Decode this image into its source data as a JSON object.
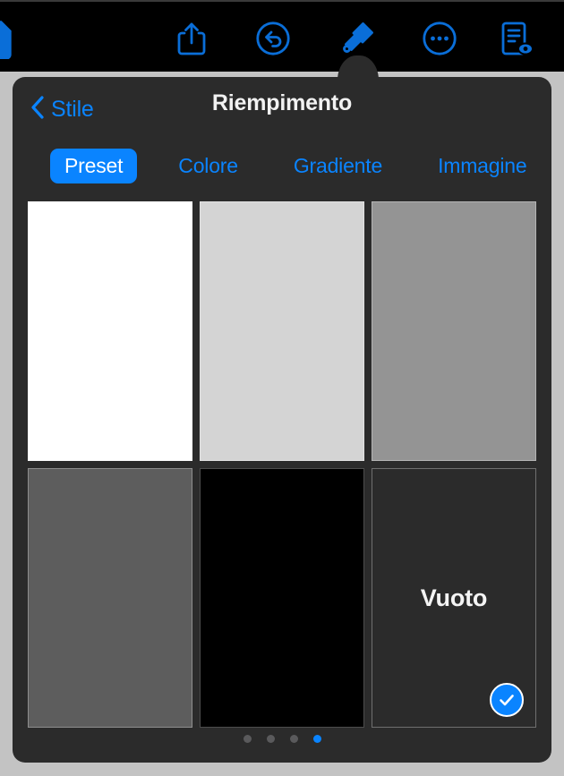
{
  "toolbar": {
    "background": "#000000",
    "tint": "#0a6ed8",
    "items": [
      {
        "name": "document-icon",
        "label": "Documento"
      },
      {
        "name": "share-icon",
        "label": "Condividi"
      },
      {
        "name": "undo-icon",
        "label": "Annulla"
      },
      {
        "name": "format-brush-icon",
        "label": "Formato",
        "active": true
      },
      {
        "name": "more-icon",
        "label": "Altro"
      },
      {
        "name": "comment-doc-icon",
        "label": "Visualizza commenti"
      }
    ]
  },
  "popover": {
    "background": "#2b2b2b",
    "header": {
      "back_label": "Stile",
      "title": "Riempimento"
    },
    "tabs": [
      {
        "label": "Preset",
        "selected": true
      },
      {
        "label": "Colore",
        "selected": false
      },
      {
        "label": "Gradiente",
        "selected": false
      },
      {
        "label": "Immagine",
        "selected": false
      }
    ],
    "accent_color": "#0a84ff",
    "swatches": [
      {
        "name": "swatch-white",
        "color": "#ffffff",
        "label": "",
        "selected": false
      },
      {
        "name": "swatch-light-gray",
        "color": "#d4d4d4",
        "label": "",
        "selected": false
      },
      {
        "name": "swatch-gray",
        "color": "#949494",
        "label": "",
        "selected": false
      },
      {
        "name": "swatch-dark-gray",
        "color": "#5d5d5d",
        "label": "",
        "selected": false
      },
      {
        "name": "swatch-black",
        "color": "#000000",
        "label": "",
        "selected": false
      },
      {
        "name": "swatch-empty",
        "color": "",
        "label": "Vuoto",
        "selected": true
      }
    ],
    "page_dots": {
      "count": 4,
      "active_index": 3
    }
  }
}
